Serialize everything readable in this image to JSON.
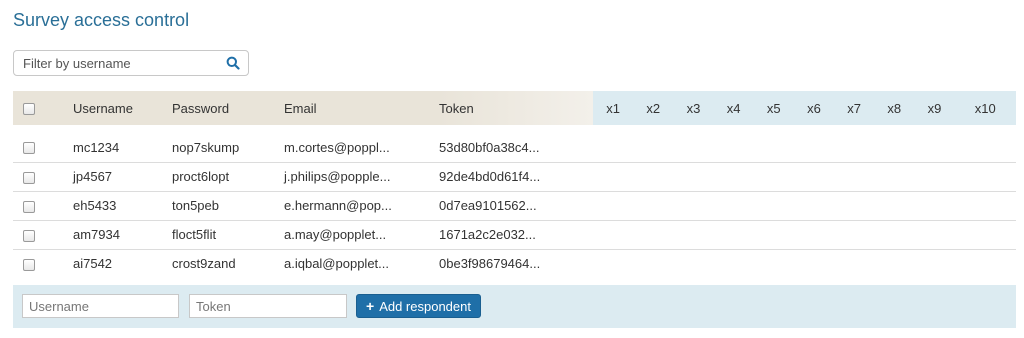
{
  "page": {
    "title": "Survey access control"
  },
  "filter": {
    "placeholder": "Filter by username"
  },
  "table": {
    "columns": [
      "Username",
      "Password",
      "Email",
      "Token"
    ],
    "extra_columns": [
      "x1",
      "x2",
      "x3",
      "x4",
      "x5",
      "x6",
      "x7",
      "x8",
      "x9",
      "x10"
    ],
    "rows": [
      {
        "username": "mc1234",
        "password": "nop7skump",
        "email": "m.cortes@poppl...",
        "token": "53d80bf0a38c4..."
      },
      {
        "username": "jp4567",
        "password": "proct6lopt",
        "email": "j.philips@popple...",
        "token": "92de4bd0d61f4..."
      },
      {
        "username": "eh5433",
        "password": "ton5peb",
        "email": "e.hermann@pop...",
        "token": "0d7ea9101562..."
      },
      {
        "username": "am7934",
        "password": "floct5flit",
        "email": "a.may@popplet...",
        "token": "1671a2c2e032..."
      },
      {
        "username": "ai7542",
        "password": "crost9zand",
        "email": "a.iqbal@popplet...",
        "token": "0be3f98679464..."
      }
    ]
  },
  "add": {
    "username_placeholder": "Username",
    "token_placeholder": "Token",
    "button_label": "Add respondent"
  },
  "colors": {
    "title": "#2a6f97",
    "header_bg": "#e9e4d9",
    "x_header_bg": "#dcebf1",
    "button_bg": "#1f6fa8"
  }
}
